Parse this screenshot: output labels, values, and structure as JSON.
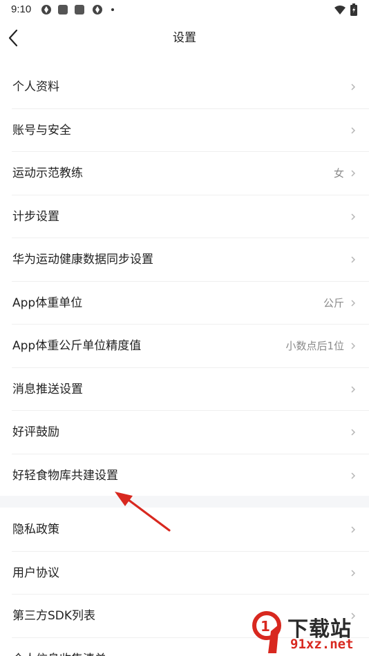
{
  "status_bar": {
    "time": "9:10"
  },
  "header": {
    "title": "设置"
  },
  "settings_group1": [
    {
      "label": "个人资料",
      "value": ""
    },
    {
      "label": "账号与安全",
      "value": ""
    },
    {
      "label": "运动示范教练",
      "value": "女"
    },
    {
      "label": "计步设置",
      "value": ""
    },
    {
      "label": "华为运动健康数据同步设置",
      "value": ""
    },
    {
      "label": "App体重单位",
      "value": "公斤"
    },
    {
      "label": "App体重公斤单位精度值",
      "value": "小数点后1位"
    },
    {
      "label": "消息推送设置",
      "value": ""
    },
    {
      "label": "好评鼓励",
      "value": ""
    },
    {
      "label": "好轻食物库共建设置",
      "value": ""
    }
  ],
  "settings_group2": [
    {
      "label": "隐私政策"
    },
    {
      "label": "用户协议"
    },
    {
      "label": "第三方SDK列表"
    },
    {
      "label": "个人信息收集清单"
    }
  ],
  "watermark": {
    "text": "下载站",
    "url": "91xz.net"
  },
  "colors": {
    "annotation_arrow": "#d8281f",
    "section_gap": "#f5f6f8",
    "secondary_text": "#8a8a8a"
  }
}
